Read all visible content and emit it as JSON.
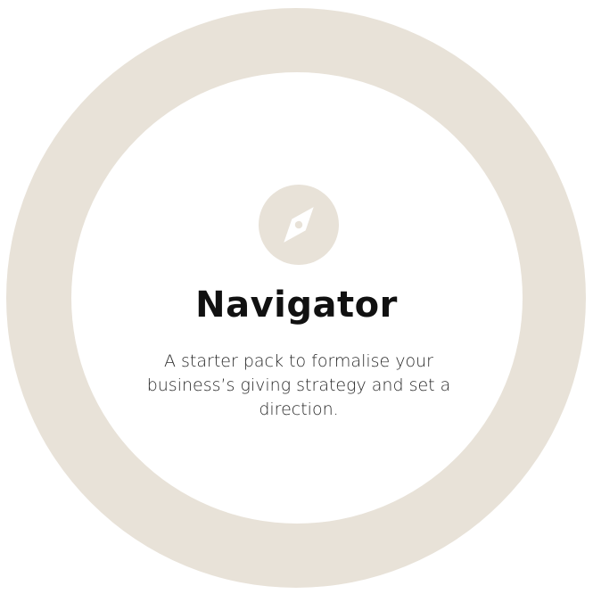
{
  "card": {
    "title": "Navigator",
    "description": "A starter pack to formalise your business’s giving strategy and set a direction.",
    "icon": "compass-icon"
  },
  "colors": {
    "ring": "#e8e2d8",
    "background": "#ffffff",
    "text": "#111111"
  }
}
